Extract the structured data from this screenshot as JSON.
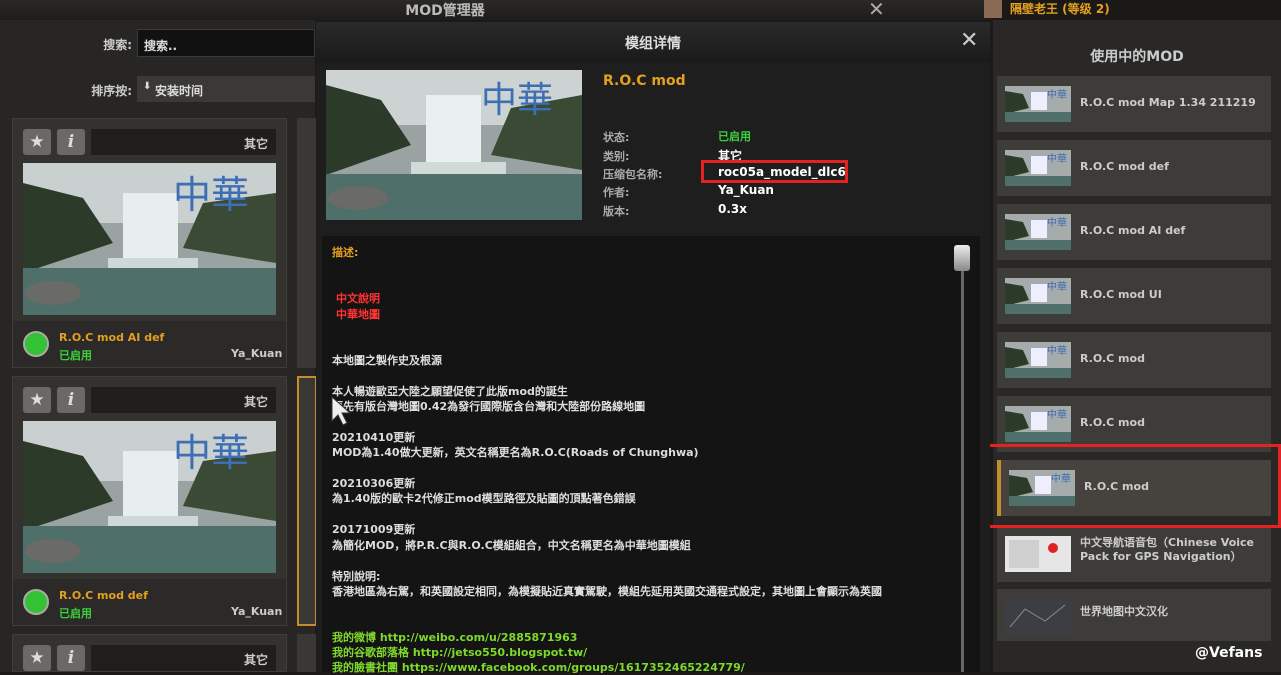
{
  "mod_manager": {
    "title": "MOD管理器",
    "close_glyph": "✕",
    "search_label": "搜索:",
    "search_value": "搜索..",
    "sort_label": "排序按:",
    "sort_value": "安装时间",
    "sort_icon": "arrow-down-icon"
  },
  "mod_cards": [
    {
      "category": "其它",
      "name": "R.O.C mod AI def",
      "status": "已启用",
      "author": "Ya_Kuan"
    },
    {
      "category": "其它",
      "name": "R.O.C mod def",
      "status": "已启用",
      "author": "Ya_Kuan"
    },
    {
      "category": "其它"
    }
  ],
  "card_buttons": {
    "star": "★",
    "info": "i"
  },
  "thumb_text": "中華",
  "user": {
    "name": "隔壁老王 (等级 2)"
  },
  "active_panel": {
    "title": "使用中的MOD",
    "items": [
      {
        "label": "R.O.C mod Map 1.34 211219"
      },
      {
        "label": "R.O.C mod def"
      },
      {
        "label": "R.O.C mod AI def"
      },
      {
        "label": "R.O.C mod UI"
      },
      {
        "label": "R.O.C mod"
      },
      {
        "label": "R.O.C mod"
      },
      {
        "label": "R.O.C mod"
      },
      {
        "label": "中文导航语音包（Chinese Voice Pack for GPS Navigation）"
      },
      {
        "label": "世界地图中文汉化"
      }
    ]
  },
  "detail": {
    "title": "模组详情",
    "close_glyph": "✕",
    "mod_name": "R.O.C mod",
    "rows": [
      {
        "key": "状态:",
        "value": "已启用"
      },
      {
        "key": "类别:",
        "value": "其它"
      },
      {
        "key": "压缩包名称:",
        "value": "roc05a_model_dlc6"
      },
      {
        "key": "作者:",
        "value": "Ya_Kuan"
      },
      {
        "key": "版本:",
        "value": "0.3x"
      }
    ],
    "desc_label": "描述:",
    "desc_red": [
      "中文說明",
      "中華地圖"
    ],
    "desc_lines": [
      "本地圖之製作史及根源",
      "本人暢遊歐亞大陸之願望促使了此版mod的誕生",
      "原先有版台灣地圖0.42為發行國際版含台灣和大陸部份路線地圖",
      "20210410更新",
      "MOD為1.40做大更新，英文名稱更名為R.O.C(Roads of Chunghwa)",
      "20210306更新",
      "為1.40版的歐卡2代修正mod模型路徑及貼圖的頂點著色錯誤",
      "20171009更新",
      "為簡化MOD，將P.R.C與R.O.C模組組合，中文名稱更名為中華地圖模組",
      "特別說明:",
      "香港地區為右駕，和英國設定相同，為模擬貼近真實駕駛，模組先延用英國交通程式設定，其地圖上會顯示為英國"
    ],
    "desc_links": [
      "我的微博 http://weibo.com/u/2885871963",
      "我的谷歌部落格 http://jetso550.blogspot.tw/",
      "我的臉書社團 https://www.facebook.com/groups/1617352465224779/"
    ]
  },
  "watermark": "@Vefans",
  "colors": {
    "accent_orange": "#e3a020",
    "status_green": "#39d239",
    "highlight_red": "#e32222"
  }
}
